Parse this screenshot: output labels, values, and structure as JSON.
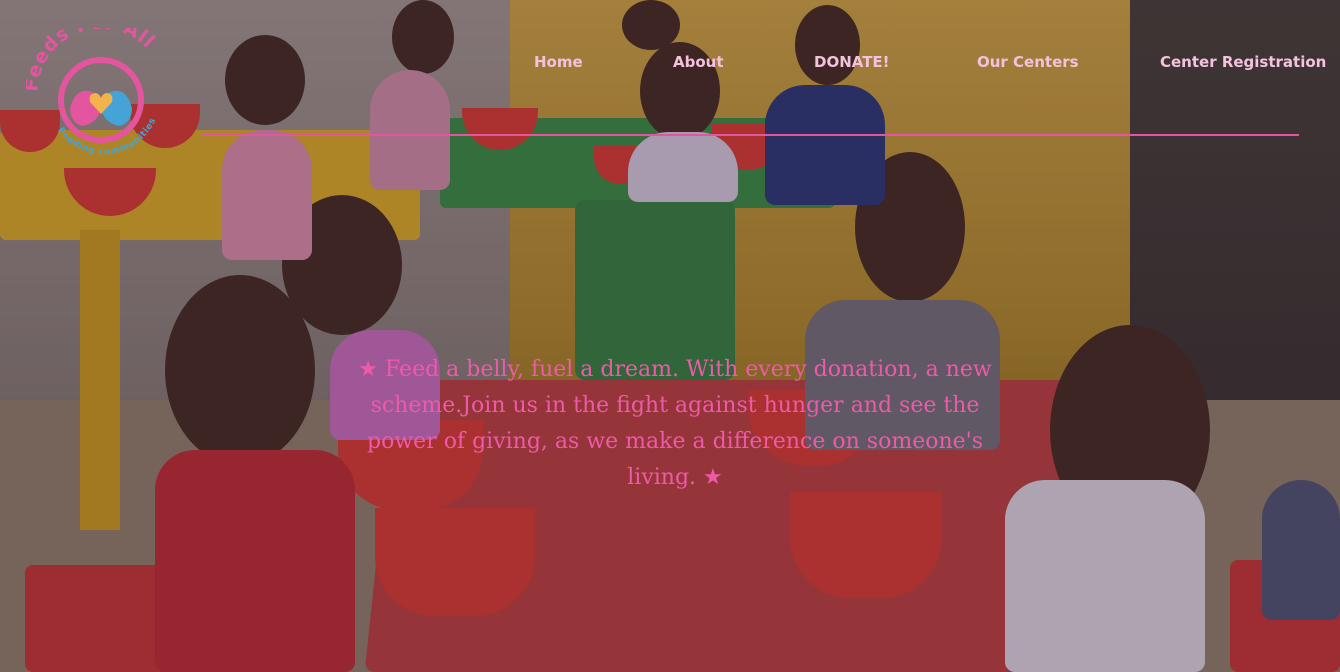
{
  "brand": {
    "name": "Feeds For All",
    "tagline": "Feeding communities",
    "colors": {
      "pink": "#e4559f",
      "blue": "#45a3d8",
      "gold": "#f4b24a"
    }
  },
  "nav": {
    "items": [
      {
        "label": "Home"
      },
      {
        "label": "About"
      },
      {
        "label": "DONATE!"
      },
      {
        "label": "Our Centers"
      },
      {
        "label": "Center Registration"
      }
    ]
  },
  "hero": {
    "message": "★ Feed a belly, fuel a dream. With every donation, a new scheme.Join us in the fight against hunger and see the power of giving, as we make a difference on someone's living. ★",
    "accent_color": "#ee5aa8"
  }
}
